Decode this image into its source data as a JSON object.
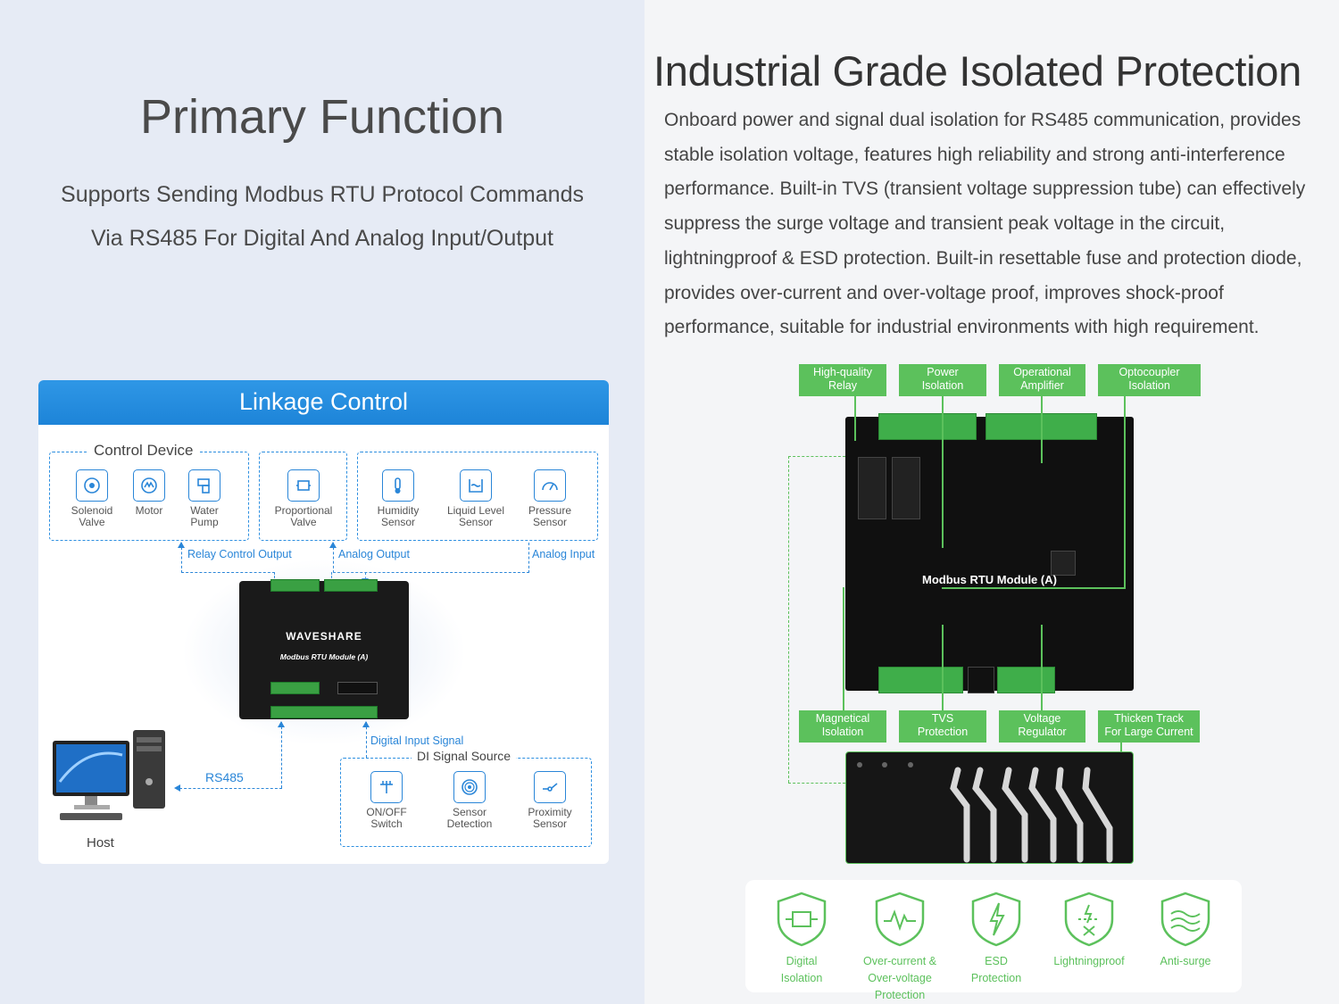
{
  "left": {
    "title": "Primary Function",
    "subtitle_line1": "Supports Sending Modbus RTU Protocol Commands",
    "subtitle_line2": "Via RS485  For Digital And Analog Input/Output",
    "linkage": {
      "header": "Linkage Control",
      "control_device_label": "Control Device",
      "devices": [
        {
          "label1": "Solenoid",
          "label2": "Valve",
          "icon": "solenoid-valve-icon"
        },
        {
          "label1": "Motor",
          "label2": "",
          "icon": "motor-icon"
        },
        {
          "label1": "Water",
          "label2": "Pump",
          "icon": "water-pump-icon"
        },
        {
          "label1": "Proportional",
          "label2": "Valve",
          "icon": "proportional-valve-icon"
        },
        {
          "label1": "Humidity",
          "label2": "Sensor",
          "icon": "humidity-sensor-icon"
        },
        {
          "label1": "Liquid Level",
          "label2": "Sensor",
          "icon": "liquid-level-sensor-icon"
        },
        {
          "label1": "Pressure",
          "label2": "Sensor",
          "icon": "pressure-sensor-icon"
        }
      ],
      "relay_output": "Relay Control Output",
      "analog_output": "Analog Output",
      "analog_input": "Analog Input",
      "module_brand": "WAVESHARE",
      "module_name": "Modbus RTU Module (A)",
      "digital_input_signal": "Digital Input Signal",
      "di_source_label": "DI Signal Source",
      "di_devices": [
        {
          "label1": "ON/OFF",
          "label2": "Switch",
          "icon": "switch-icon"
        },
        {
          "label1": "Sensor",
          "label2": "Detection",
          "icon": "sensor-detection-icon"
        },
        {
          "label1": "Proximity",
          "label2": "Sensor",
          "icon": "proximity-sensor-icon"
        }
      ],
      "rs485": "RS485",
      "host": "Host"
    }
  },
  "right": {
    "title": "Industrial Grade Isolated Protection",
    "paragraph_lines": [
      "Onboard power and signal dual isolation for RS485 communication, provides",
      "stable isolation voltage, features high reliability and strong anti-interference",
      "performance. Built-in TVS (transient voltage suppression tube) can effectively",
      "suppress the surge voltage and transient peak voltage in the circuit,",
      "lightningproof & ESD protection. Built-in resettable fuse and protection diode,",
      "provides over-current and over-voltage proof, improves shock-proof",
      "performance, suitable for industrial environments with high requirement."
    ],
    "top_labels": [
      {
        "l1": "High-quality",
        "l2": "Relay"
      },
      {
        "l1": "Power",
        "l2": "Isolation"
      },
      {
        "l1": "Operational",
        "l2": "Amplifier"
      },
      {
        "l1": "Optocoupler",
        "l2": "Isolation"
      }
    ],
    "bottom_labels": [
      {
        "l1": "Magnetical",
        "l2": "Isolation"
      },
      {
        "l1": "TVS",
        "l2": "Protection"
      },
      {
        "l1": "Voltage",
        "l2": "Regulator"
      },
      {
        "l1": "Thicken Track",
        "l2": "For Large Current"
      }
    ],
    "board_title": "Modbus RTU Module (A)",
    "features": [
      {
        "l1": "Digital",
        "l2": "Isolation",
        "icon": "digital-isolation-icon"
      },
      {
        "l1": "Over-current &",
        "l2": "Over-voltage Protection",
        "icon": "over-current-icon"
      },
      {
        "l1": "ESD",
        "l2": "Protection",
        "icon": "esd-protection-icon"
      },
      {
        "l1": "Lightningproof",
        "l2": "",
        "icon": "lightningproof-icon"
      },
      {
        "l1": "Anti-surge",
        "l2": "",
        "icon": "anti-surge-icon"
      }
    ],
    "accent_green": "#5cc15c"
  },
  "colors": {
    "blue": "#2a86d8",
    "header_blue": "#1d84d8"
  }
}
